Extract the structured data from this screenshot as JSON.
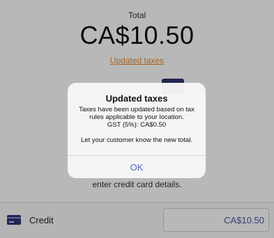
{
  "checkout": {
    "total_label": "Total",
    "total_amount": "CA$10.50",
    "tax_link": "Updated taxes",
    "hint": "enter credit card details."
  },
  "payment": {
    "method_label": "Credit",
    "amount_value": "CA$10.50"
  },
  "alert": {
    "title": "Updated taxes",
    "message_line1": "Taxes have been updated based on tax",
    "message_line2": "rules applicable to your location.",
    "message_line3": "GST (5%): CA$0.50",
    "message_line4": "Let your customer know the new total.",
    "ok_label": "OK"
  },
  "colors": {
    "link": "#e98a2a",
    "accent": "#5560c2",
    "card": "#2b3478"
  },
  "icons": {
    "payment_method": "credit-card-icon"
  }
}
